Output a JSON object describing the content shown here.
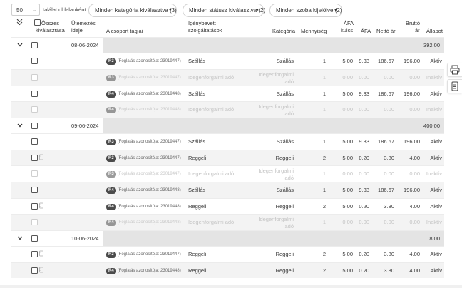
{
  "toolbar": {
    "per_page": "50",
    "per_page_label": "találat oldalanként",
    "filter_category": "Minden kategória kiválasztva (3)",
    "filter_status": "Minden státusz kiválasztva (2)",
    "filter_room": "Minden szoba kijelölve (2)"
  },
  "headers": {
    "select_all_1": "Összes",
    "select_all_2": "kiválasztása",
    "schedule_1": "Ütemezés",
    "schedule_2": "ideje",
    "group_members": "A csoport tagjai",
    "services_1": "Igénybevett",
    "services_2": "szolgáltatások",
    "category": "Kategória",
    "quantity": "Mennyiség",
    "vat_rate_1": "ÁFA",
    "vat_rate_2": "kulcs",
    "vat": "ÁFA",
    "net": "Nettó ár",
    "gross_1": "Bruttó",
    "gross_2": "ár",
    "status": "Állapot"
  },
  "rows": [
    {
      "type": "group",
      "date": "08-06-2024",
      "total": "392.00"
    },
    {
      "type": "item",
      "tag": "R3",
      "booking": "(Foglalás azonosítója: 23019447)",
      "service": "Szállás",
      "category": "Szállás",
      "qty": "1",
      "rate": "5.00",
      "vat": "9.33",
      "net": "186.67",
      "gross": "196.00",
      "status": "Aktív",
      "dim": false,
      "icon": false
    },
    {
      "type": "item",
      "tag": "R3",
      "booking": "(Foglalás azonosítója: 23019447)",
      "service": "Idegenforgalmi adó",
      "category": "Idegenforgalmi adó",
      "qty": "1",
      "rate": "0.00",
      "vat": "0.00",
      "net": "0.00",
      "gross": "0.00",
      "status": "Inaktív",
      "dim": true,
      "icon": false
    },
    {
      "type": "item",
      "tag": "R4",
      "booking": "(Foglalás azonosítója: 23019448)",
      "service": "Szállás",
      "category": "Szállás",
      "qty": "1",
      "rate": "5.00",
      "vat": "9.33",
      "net": "186.67",
      "gross": "196.00",
      "status": "Aktív",
      "dim": false,
      "icon": false
    },
    {
      "type": "item",
      "tag": "R4",
      "booking": "(Foglalás azonosítója: 23019448)",
      "service": "Idegenforgalmi adó",
      "category": "Idegenforgalmi adó",
      "qty": "1",
      "rate": "0.00",
      "vat": "0.00",
      "net": "0.00",
      "gross": "0.00",
      "status": "Inaktív",
      "dim": true,
      "icon": false
    },
    {
      "type": "group",
      "date": "09-06-2024",
      "total": "400.00"
    },
    {
      "type": "item",
      "tag": "R3",
      "booking": "(Foglalás azonosítója: 23019447)",
      "service": "Szállás",
      "category": "Szállás",
      "qty": "1",
      "rate": "5.00",
      "vat": "9.33",
      "net": "186.67",
      "gross": "196.00",
      "status": "Aktív",
      "dim": false,
      "icon": false
    },
    {
      "type": "item",
      "tag": "R3",
      "booking": "(Foglalás azonosítója: 23019447)",
      "service": "Reggeli",
      "category": "Reggeli",
      "qty": "2",
      "rate": "5.00",
      "vat": "0.20",
      "net": "3.80",
      "gross": "4.00",
      "status": "Aktív",
      "dim": false,
      "icon": true
    },
    {
      "type": "item",
      "tag": "R3",
      "booking": "(Foglalás azonosítója: 23019447)",
      "service": "Idegenforgalmi adó",
      "category": "Idegenforgalmi adó",
      "qty": "1",
      "rate": "0.00",
      "vat": "0.00",
      "net": "0.00",
      "gross": "0.00",
      "status": "Inaktív",
      "dim": true,
      "icon": false
    },
    {
      "type": "item",
      "tag": "R4",
      "booking": "(Foglalás azonosítója: 23019448)",
      "service": "Szállás",
      "category": "Szállás",
      "qty": "1",
      "rate": "5.00",
      "vat": "9.33",
      "net": "186.67",
      "gross": "196.00",
      "status": "Aktív",
      "dim": false,
      "icon": false
    },
    {
      "type": "item",
      "tag": "R4",
      "booking": "(Foglalás azonosítója: 23019448)",
      "service": "Reggeli",
      "category": "Reggeli",
      "qty": "2",
      "rate": "5.00",
      "vat": "0.20",
      "net": "3.80",
      "gross": "4.00",
      "status": "Aktív",
      "dim": false,
      "icon": true
    },
    {
      "type": "item",
      "tag": "R4",
      "booking": "(Foglalás azonosítója: 23019448)",
      "service": "Idegenforgalmi adó",
      "category": "Idegenforgalmi adó",
      "qty": "1",
      "rate": "0.00",
      "vat": "0.00",
      "net": "0.00",
      "gross": "0.00",
      "status": "Inaktív",
      "dim": true,
      "icon": false
    },
    {
      "type": "group",
      "date": "10-06-2024",
      "total": "8.00"
    },
    {
      "type": "item",
      "tag": "R3",
      "booking": "(Foglalás azonosítója: 23019447)",
      "service": "Reggeli",
      "category": "Reggeli",
      "qty": "2",
      "rate": "5.00",
      "vat": "0.20",
      "net": "3.80",
      "gross": "4.00",
      "status": "Aktív",
      "dim": false,
      "icon": true
    },
    {
      "type": "item",
      "tag": "R4",
      "booking": "(Foglalás azonosítója: 23019448)",
      "service": "Reggeli",
      "category": "Reggeli",
      "qty": "2",
      "rate": "5.00",
      "vat": "0.20",
      "net": "3.80",
      "gross": "4.00",
      "status": "Aktív",
      "dim": false,
      "icon": true
    }
  ],
  "side": {
    "print_icon": "printer-icon",
    "doc_icon": "document-icon"
  },
  "colors": {
    "group_band": "#e4e4e4",
    "alt_row": "#f3f3f3",
    "tag_bg": "#4b4b4b"
  }
}
